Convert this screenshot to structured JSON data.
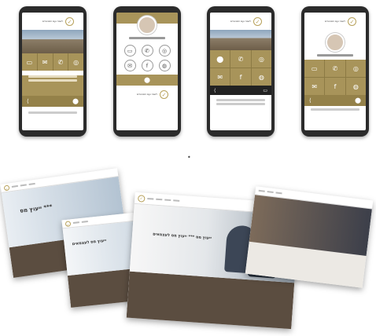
{
  "colors": {
    "gold": "#a8945a",
    "dark": "#2b2b2b",
    "brown": "#5b4d40"
  },
  "phones": {
    "logo_text": "לשכה ועם הסניגורים",
    "institute": "INSTITUTE OF TAX CONSULTANTS IN ISRAEL",
    "contact_labels": [
      "דואר",
      "טלפון",
      "ווטסאפ",
      "אנשי קשר"
    ],
    "share_icon": "share-icon",
    "location_icon": "location-pin-icon"
  },
  "pages": {
    "hero_title_left": "ייעוץ מס ***",
    "hero_subtitle_left": "ייעוץ מס לעצמאים",
    "hero_title_center": "ייעוץ מס *** ייעוץ מס לעצמאים",
    "dot_separator": "•"
  }
}
